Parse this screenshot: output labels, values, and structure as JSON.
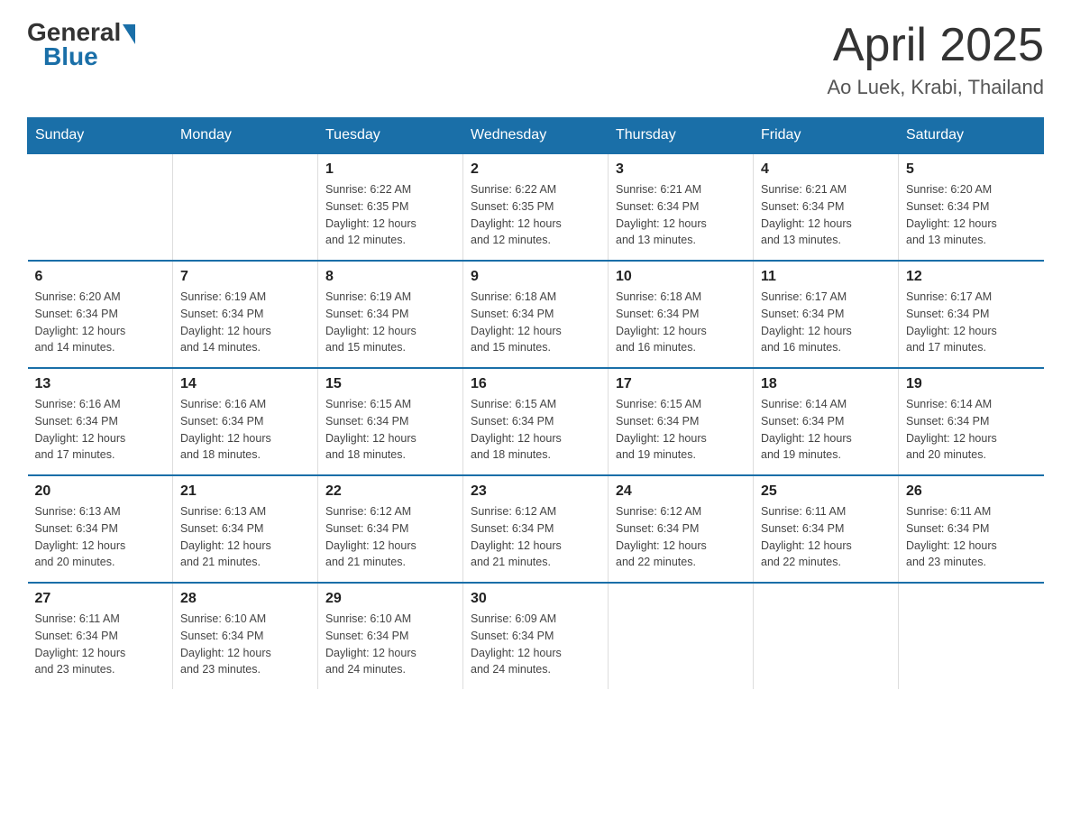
{
  "header": {
    "logo_general": "General",
    "logo_blue": "Blue",
    "month_title": "April 2025",
    "location": "Ao Luek, Krabi, Thailand"
  },
  "days_of_week": [
    "Sunday",
    "Monday",
    "Tuesday",
    "Wednesday",
    "Thursday",
    "Friday",
    "Saturday"
  ],
  "weeks": [
    [
      {
        "day": "",
        "info": ""
      },
      {
        "day": "",
        "info": ""
      },
      {
        "day": "1",
        "info": "Sunrise: 6:22 AM\nSunset: 6:35 PM\nDaylight: 12 hours\nand 12 minutes."
      },
      {
        "day": "2",
        "info": "Sunrise: 6:22 AM\nSunset: 6:35 PM\nDaylight: 12 hours\nand 12 minutes."
      },
      {
        "day": "3",
        "info": "Sunrise: 6:21 AM\nSunset: 6:34 PM\nDaylight: 12 hours\nand 13 minutes."
      },
      {
        "day": "4",
        "info": "Sunrise: 6:21 AM\nSunset: 6:34 PM\nDaylight: 12 hours\nand 13 minutes."
      },
      {
        "day": "5",
        "info": "Sunrise: 6:20 AM\nSunset: 6:34 PM\nDaylight: 12 hours\nand 13 minutes."
      }
    ],
    [
      {
        "day": "6",
        "info": "Sunrise: 6:20 AM\nSunset: 6:34 PM\nDaylight: 12 hours\nand 14 minutes."
      },
      {
        "day": "7",
        "info": "Sunrise: 6:19 AM\nSunset: 6:34 PM\nDaylight: 12 hours\nand 14 minutes."
      },
      {
        "day": "8",
        "info": "Sunrise: 6:19 AM\nSunset: 6:34 PM\nDaylight: 12 hours\nand 15 minutes."
      },
      {
        "day": "9",
        "info": "Sunrise: 6:18 AM\nSunset: 6:34 PM\nDaylight: 12 hours\nand 15 minutes."
      },
      {
        "day": "10",
        "info": "Sunrise: 6:18 AM\nSunset: 6:34 PM\nDaylight: 12 hours\nand 16 minutes."
      },
      {
        "day": "11",
        "info": "Sunrise: 6:17 AM\nSunset: 6:34 PM\nDaylight: 12 hours\nand 16 minutes."
      },
      {
        "day": "12",
        "info": "Sunrise: 6:17 AM\nSunset: 6:34 PM\nDaylight: 12 hours\nand 17 minutes."
      }
    ],
    [
      {
        "day": "13",
        "info": "Sunrise: 6:16 AM\nSunset: 6:34 PM\nDaylight: 12 hours\nand 17 minutes."
      },
      {
        "day": "14",
        "info": "Sunrise: 6:16 AM\nSunset: 6:34 PM\nDaylight: 12 hours\nand 18 minutes."
      },
      {
        "day": "15",
        "info": "Sunrise: 6:15 AM\nSunset: 6:34 PM\nDaylight: 12 hours\nand 18 minutes."
      },
      {
        "day": "16",
        "info": "Sunrise: 6:15 AM\nSunset: 6:34 PM\nDaylight: 12 hours\nand 18 minutes."
      },
      {
        "day": "17",
        "info": "Sunrise: 6:15 AM\nSunset: 6:34 PM\nDaylight: 12 hours\nand 19 minutes."
      },
      {
        "day": "18",
        "info": "Sunrise: 6:14 AM\nSunset: 6:34 PM\nDaylight: 12 hours\nand 19 minutes."
      },
      {
        "day": "19",
        "info": "Sunrise: 6:14 AM\nSunset: 6:34 PM\nDaylight: 12 hours\nand 20 minutes."
      }
    ],
    [
      {
        "day": "20",
        "info": "Sunrise: 6:13 AM\nSunset: 6:34 PM\nDaylight: 12 hours\nand 20 minutes."
      },
      {
        "day": "21",
        "info": "Sunrise: 6:13 AM\nSunset: 6:34 PM\nDaylight: 12 hours\nand 21 minutes."
      },
      {
        "day": "22",
        "info": "Sunrise: 6:12 AM\nSunset: 6:34 PM\nDaylight: 12 hours\nand 21 minutes."
      },
      {
        "day": "23",
        "info": "Sunrise: 6:12 AM\nSunset: 6:34 PM\nDaylight: 12 hours\nand 21 minutes."
      },
      {
        "day": "24",
        "info": "Sunrise: 6:12 AM\nSunset: 6:34 PM\nDaylight: 12 hours\nand 22 minutes."
      },
      {
        "day": "25",
        "info": "Sunrise: 6:11 AM\nSunset: 6:34 PM\nDaylight: 12 hours\nand 22 minutes."
      },
      {
        "day": "26",
        "info": "Sunrise: 6:11 AM\nSunset: 6:34 PM\nDaylight: 12 hours\nand 23 minutes."
      }
    ],
    [
      {
        "day": "27",
        "info": "Sunrise: 6:11 AM\nSunset: 6:34 PM\nDaylight: 12 hours\nand 23 minutes."
      },
      {
        "day": "28",
        "info": "Sunrise: 6:10 AM\nSunset: 6:34 PM\nDaylight: 12 hours\nand 23 minutes."
      },
      {
        "day": "29",
        "info": "Sunrise: 6:10 AM\nSunset: 6:34 PM\nDaylight: 12 hours\nand 24 minutes."
      },
      {
        "day": "30",
        "info": "Sunrise: 6:09 AM\nSunset: 6:34 PM\nDaylight: 12 hours\nand 24 minutes."
      },
      {
        "day": "",
        "info": ""
      },
      {
        "day": "",
        "info": ""
      },
      {
        "day": "",
        "info": ""
      }
    ]
  ]
}
